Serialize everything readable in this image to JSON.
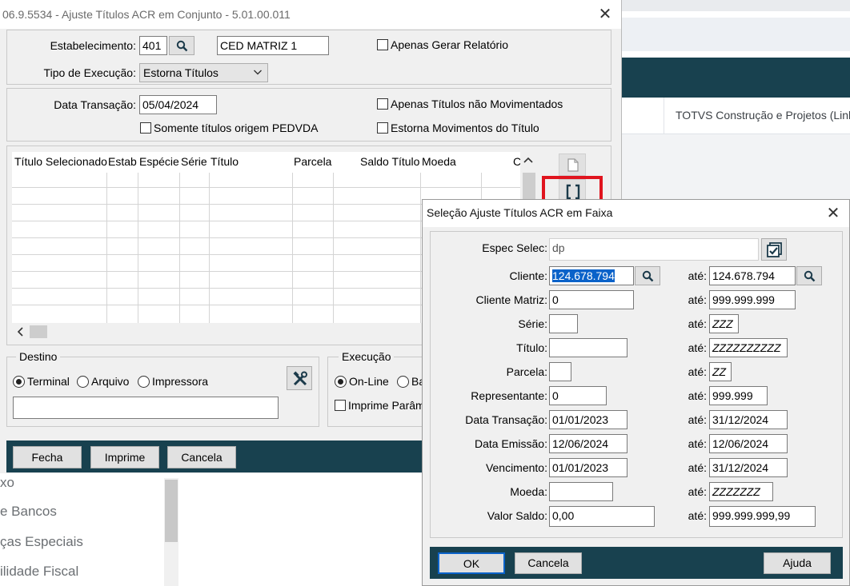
{
  "background_app": {
    "header_text": "TOTVS Construção e Projetos (Linh",
    "menu_items": [
      "xo",
      "e Bancos",
      "ças Especiais",
      "ilidade Fiscal"
    ]
  },
  "main_dialog": {
    "title": "06.9.5534 - Ajuste Títulos ACR em Conjunto - 5.01.00.011",
    "estabelecimento_label": "Estabelecimento:",
    "estabelecimento_value": "401",
    "estabelecimento_nome": "CED MATRIZ 1",
    "apenas_gerar_relatorio": "Apenas Gerar Relatório",
    "tipo_execucao_label": "Tipo de Execução:",
    "tipo_execucao_value": "Estorna Títulos",
    "data_transacao_label": "Data Transação:",
    "data_transacao_value": "05/04/2024",
    "apenas_nao_movimentados": "Apenas Títulos não Movimentados",
    "somente_pedvda": "Somente títulos origem PEDVDA",
    "estorna_movimentos": "Estorna Movimentos do Título",
    "table_columns": [
      "Título Selecionado",
      "Estab",
      "Espécie",
      "Série",
      "Título",
      "Parcela",
      "Saldo Título",
      "Moeda",
      "C"
    ],
    "destino_label": "Destino",
    "destino_options": [
      "Terminal",
      "Arquivo",
      "Impressora"
    ],
    "destino_selected": "Terminal",
    "execucao_label": "Execução",
    "execucao_options": [
      "On-Line",
      "Ba"
    ],
    "imprime_parametros": "Imprime Parâme",
    "buttons": {
      "fecha": "Fecha",
      "imprime": "Imprime",
      "cancela": "Cancela"
    }
  },
  "selection_dialog": {
    "title": "Seleção Ajuste Títulos ACR em Faixa",
    "espec_selec_label": "Espec Selec:",
    "espec_selec_value": "dp",
    "ate_label": "até:",
    "rows": [
      {
        "label": "Cliente:",
        "from": "124.678.794",
        "to": "124.678.794"
      },
      {
        "label": "Cliente Matriz:",
        "from": "0",
        "to": "999.999.999"
      },
      {
        "label": "Série:",
        "from": "",
        "to": "ZZZ"
      },
      {
        "label": "Título:",
        "from": "",
        "to": "ZZZZZZZZZZ"
      },
      {
        "label": "Parcela:",
        "from": "",
        "to": "ZZ"
      },
      {
        "label": "Representante:",
        "from": "0",
        "to": "999.999"
      },
      {
        "label": "Data Transação:",
        "from": "01/01/2023",
        "to": "31/12/2024"
      },
      {
        "label": "Data Emissão:",
        "from": "12/06/2024",
        "to": "12/06/2024"
      },
      {
        "label": "Vencimento:",
        "from": "01/01/2023",
        "to": "31/12/2024"
      },
      {
        "label": "Moeda:",
        "from": "",
        "to": "ZZZZZZZ"
      },
      {
        "label": "Valor Saldo:",
        "from": "0,00",
        "to": "999.999.999,99"
      }
    ],
    "buttons": {
      "ok": "OK",
      "cancela": "Cancela",
      "ajuda": "Ajuda"
    }
  },
  "colors": {
    "accent_bar": "#18414f",
    "highlight": "#e0141e",
    "selection": "#0a62c9"
  }
}
